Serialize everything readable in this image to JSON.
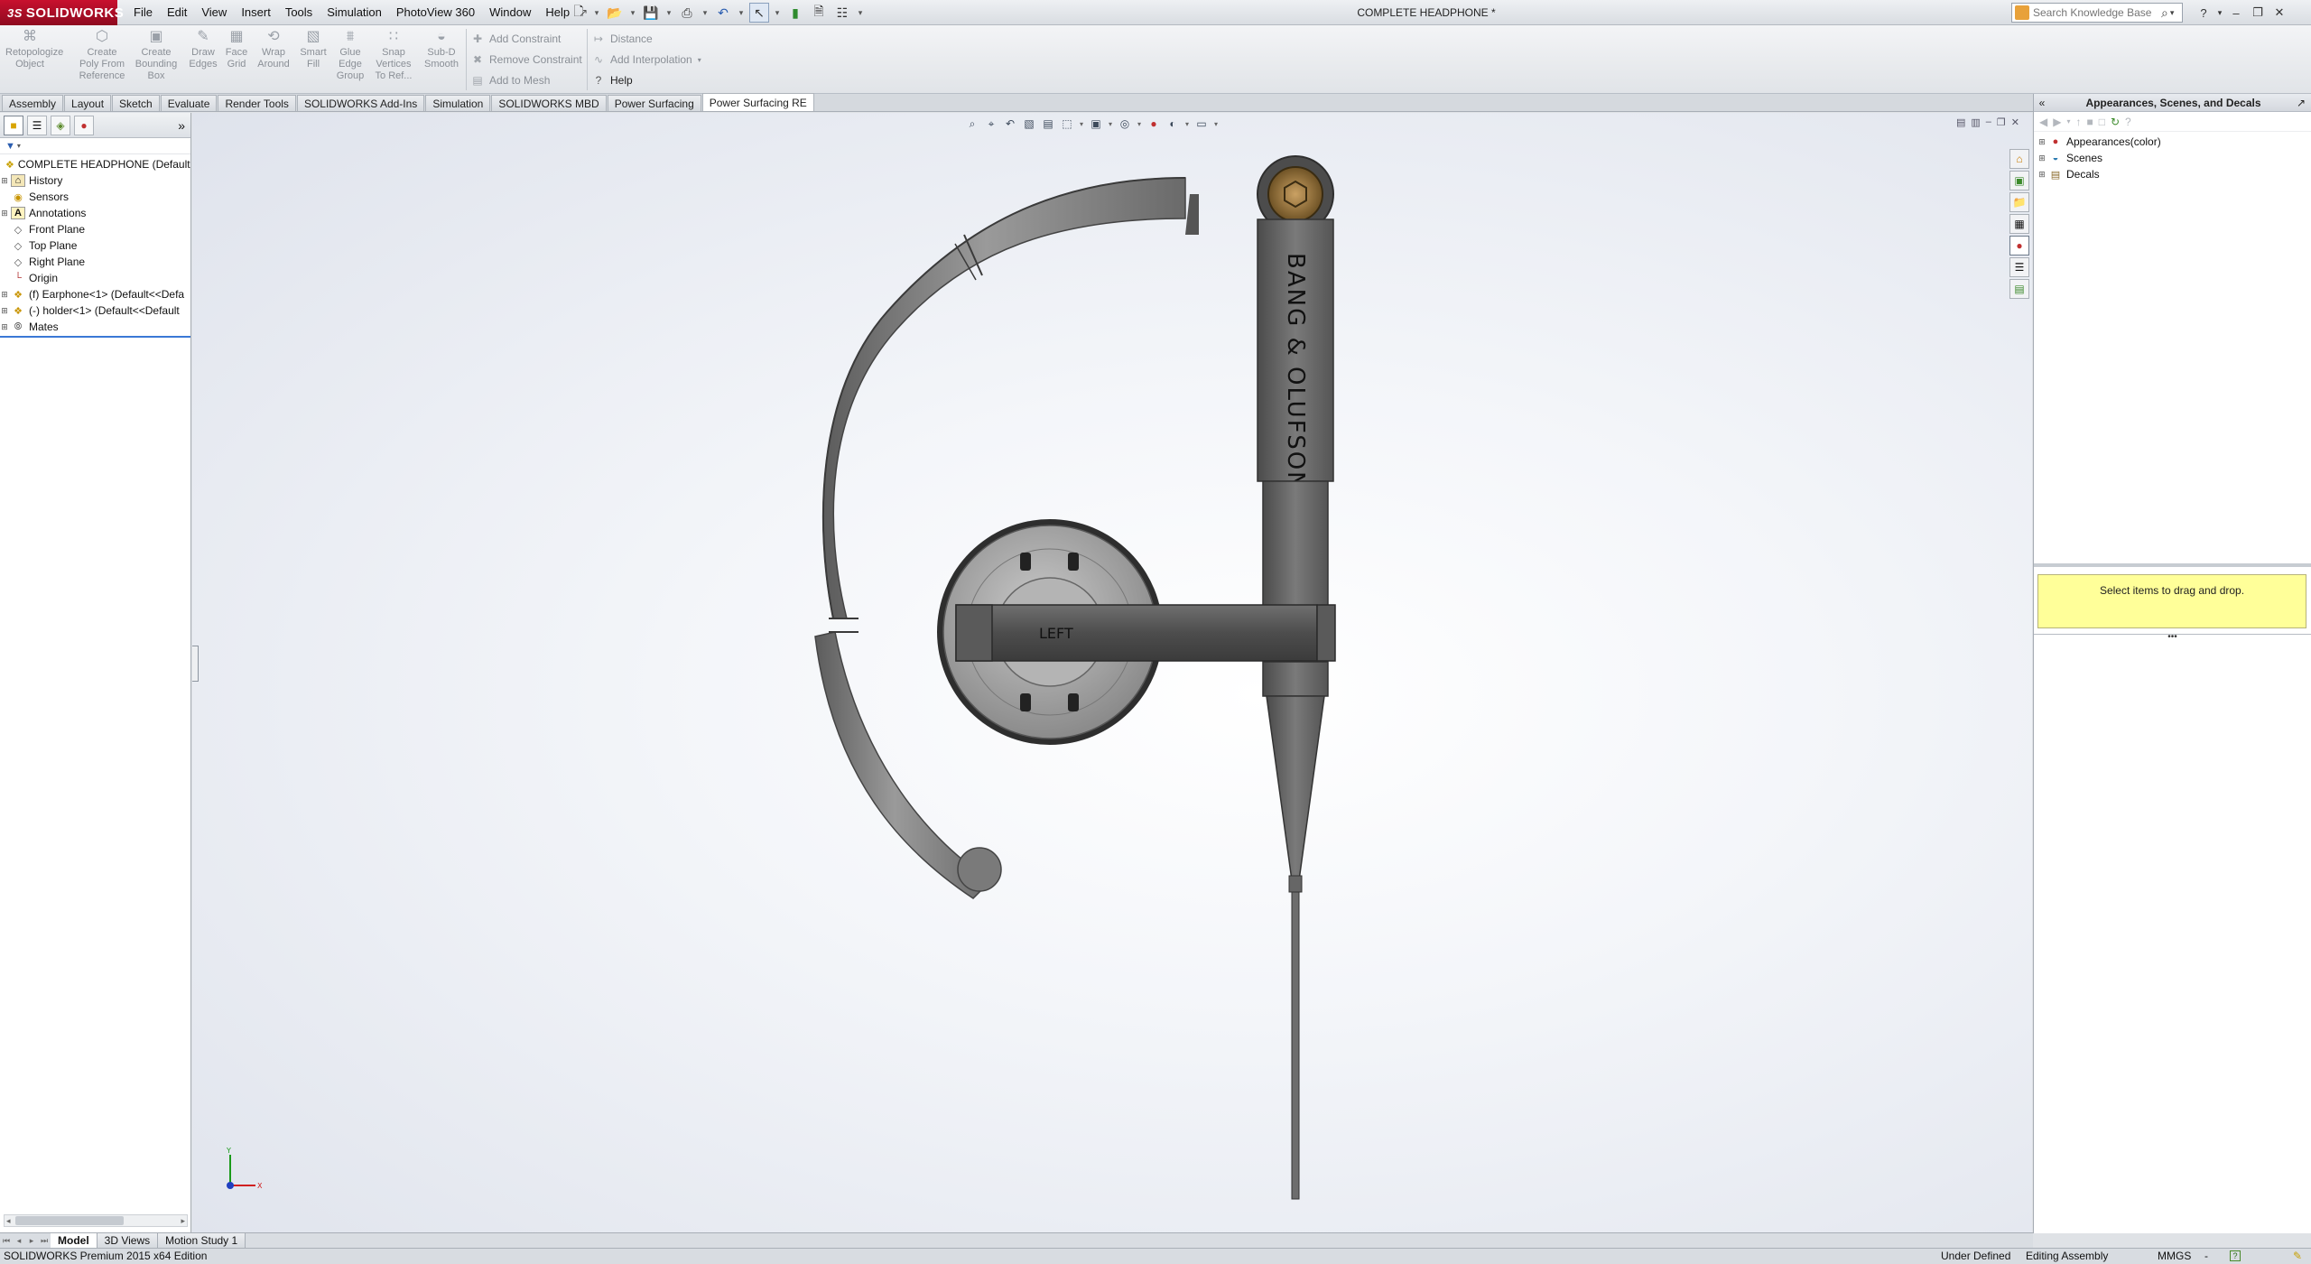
{
  "app": {
    "brand": "SOLIDWORKS",
    "document_title": "COMPLETE HEADPHONE *"
  },
  "menu": [
    "File",
    "Edit",
    "View",
    "Insert",
    "Tools",
    "Simulation",
    "PhotoView 360",
    "Window",
    "Help"
  ],
  "search": {
    "placeholder": "Search Knowledge Base"
  },
  "commandmanager": {
    "large_buttons": [
      {
        "label": "Retopologize Object",
        "lines": [
          "Retopologize",
          "Object"
        ]
      },
      {
        "label": "Create Poly From Reference",
        "lines": [
          "Create",
          "Poly From",
          "Reference"
        ]
      },
      {
        "label": "Create Bounding Box",
        "lines": [
          "Create",
          "Bounding",
          "Box"
        ]
      },
      {
        "label": "Draw Edges",
        "lines": [
          "Draw",
          "Edges"
        ]
      },
      {
        "label": "Face Grid",
        "lines": [
          "Face",
          "Grid"
        ]
      },
      {
        "label": "Wrap Around",
        "lines": [
          "Wrap",
          "Around"
        ]
      },
      {
        "label": "Smart Fill",
        "lines": [
          "Smart",
          "Fill"
        ]
      },
      {
        "label": "Glue Edge Group",
        "lines": [
          "Glue",
          "Edge",
          "Group"
        ]
      },
      {
        "label": "Snap Vertices To Ref...",
        "lines": [
          "Snap",
          "Vertices",
          "To Ref..."
        ]
      },
      {
        "label": "Sub-D Smooth",
        "lines": [
          "Sub-D",
          "Smooth"
        ]
      }
    ],
    "small_buttons_col1": [
      "Add Constraint",
      "Remove Constraint",
      "Add to Mesh"
    ],
    "small_buttons_col2": [
      "Distance",
      "Add Interpolation",
      "Help"
    ]
  },
  "tabs": {
    "items": [
      "Assembly",
      "Layout",
      "Sketch",
      "Evaluate",
      "Render Tools",
      "SOLIDWORKS Add-Ins",
      "Simulation",
      "SOLIDWORKS MBD",
      "Power Surfacing",
      "Power Surfacing RE"
    ],
    "active_index": 9
  },
  "feature_tree": {
    "root": "COMPLETE HEADPHONE  (Default<",
    "items": [
      {
        "label": "History",
        "icon": "history-icon",
        "expandable": true
      },
      {
        "label": "Sensors",
        "icon": "sensor-icon",
        "expandable": false
      },
      {
        "label": "Annotations",
        "icon": "annotation-icon",
        "expandable": true
      },
      {
        "label": "Front Plane",
        "icon": "plane-icon",
        "expandable": false
      },
      {
        "label": "Top Plane",
        "icon": "plane-icon",
        "expandable": false
      },
      {
        "label": "Right Plane",
        "icon": "plane-icon",
        "expandable": false
      },
      {
        "label": "Origin",
        "icon": "origin-icon",
        "expandable": false
      },
      {
        "label": "(f) Earphone<1> (Default<<Defa",
        "icon": "part-icon",
        "expandable": true
      },
      {
        "label": "(-) holder<1> (Default<<Default",
        "icon": "part-icon",
        "expandable": true
      },
      {
        "label": "Mates",
        "icon": "mates-icon",
        "expandable": true
      }
    ]
  },
  "model": {
    "brand_text": "BANG & OLUFSON",
    "side_label": "LEFT"
  },
  "task_pane": {
    "title": "Appearances, Scenes, and Decals",
    "tree": [
      {
        "label": "Appearances(color)",
        "icon": "appearance-icon"
      },
      {
        "label": "Scenes",
        "icon": "scene-icon"
      },
      {
        "label": "Decals",
        "icon": "decal-icon"
      }
    ],
    "drop_hint": "Select items to drag and drop."
  },
  "bottom_tabs": {
    "items": [
      "Model",
      "3D Views",
      "Motion Study 1"
    ],
    "active_index": 0
  },
  "status": {
    "edition": "SOLIDWORKS Premium 2015 x64 Edition",
    "definition": "Under Defined",
    "mode": "Editing Assembly",
    "units": "MMGS"
  },
  "colors": {
    "brand_red": "#c8102e",
    "tooltip_yellow": "#ffff99",
    "selection_blue": "#3a78d6"
  }
}
